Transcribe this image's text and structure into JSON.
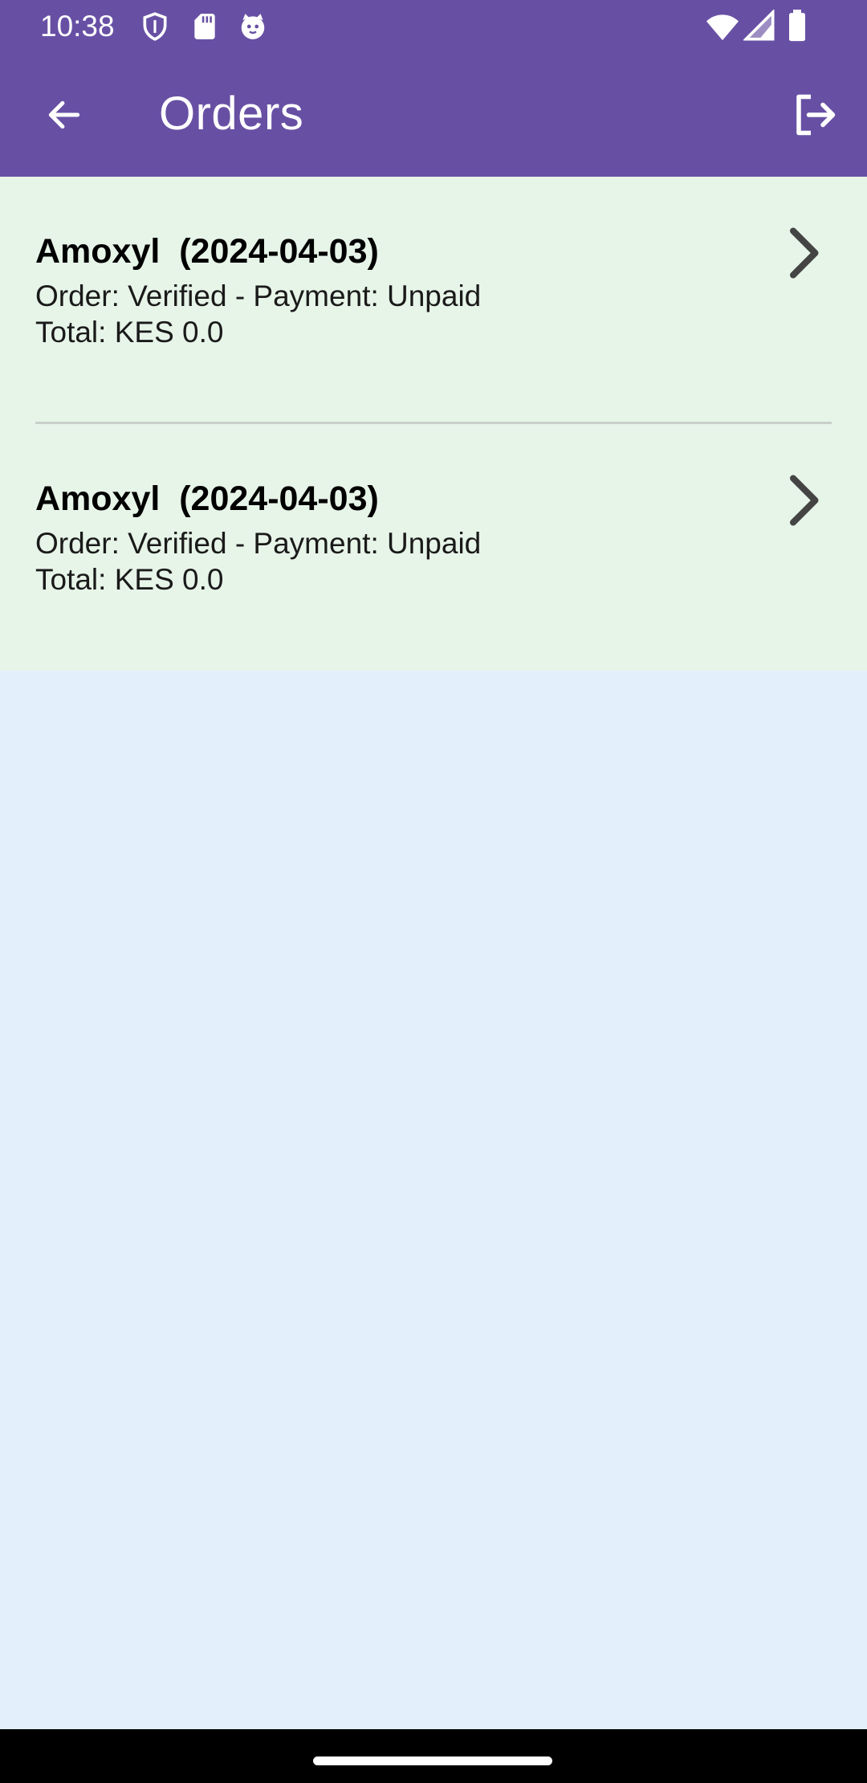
{
  "status_bar": {
    "time": "10:38",
    "left_icons": [
      "shield-icon",
      "sd-card-icon",
      "cat-face-icon"
    ],
    "right_icons": [
      "wifi-icon",
      "cell-signal-icon",
      "battery-icon"
    ]
  },
  "app_bar": {
    "title": "Orders",
    "back_icon": "arrow-left-icon",
    "logout_icon": "logout-icon"
  },
  "orders": [
    {
      "title": "Amoxyl  (2024-04-03)",
      "status": "Order: Verified - Payment: Unpaid",
      "total": "Total: KES 0.0",
      "icon": "chevron-right-icon"
    },
    {
      "title": "Amoxyl  (2024-04-03)",
      "status": "Order: Verified - Payment: Unpaid",
      "total": "Total: KES 0.0",
      "icon": "chevron-right-icon"
    }
  ],
  "colors": {
    "app_bar": "#6750a4",
    "list_background": "#e7f4e8",
    "page_background": "#e3f0fb",
    "navigation_bar": "#000000"
  }
}
